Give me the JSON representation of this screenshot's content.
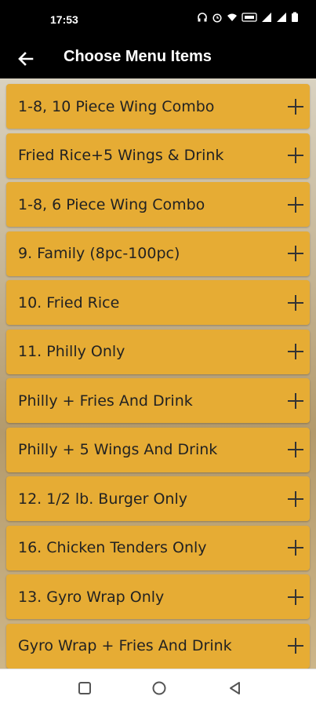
{
  "status_bar": {
    "time": "17:53",
    "icons": [
      "headphones-icon",
      "alarm-icon",
      "wifi-icon",
      "volte-icon",
      "signal-icon",
      "signal-icon",
      "battery-icon"
    ]
  },
  "app_bar": {
    "title": "Choose Menu Items",
    "back_icon": "arrow-left-icon"
  },
  "menu_items": [
    {
      "label": "1-8, 10 Piece Wing Combo"
    },
    {
      "label": "Fried Rice+5 Wings & Drink"
    },
    {
      "label": "1-8, 6 Piece Wing Combo"
    },
    {
      "label": "9. Family (8pc-100pc)"
    },
    {
      "label": "10. Fried Rice"
    },
    {
      "label": "11. Philly Only"
    },
    {
      "label": "Philly + Fries And Drink"
    },
    {
      "label": "Philly + 5 Wings And Drink"
    },
    {
      "label": "12. 1/2 lb. Burger Only"
    },
    {
      "label": "16. Chicken Tenders Only"
    },
    {
      "label": "13. Gyro Wrap Only"
    },
    {
      "label": "Gyro Wrap + Fries And Drink"
    }
  ],
  "colors": {
    "item_background": "#e6ac34",
    "app_bar": "#000000"
  },
  "nav_bar": {
    "buttons": [
      "recents-square-icon",
      "home-circle-icon",
      "back-triangle-icon"
    ]
  }
}
